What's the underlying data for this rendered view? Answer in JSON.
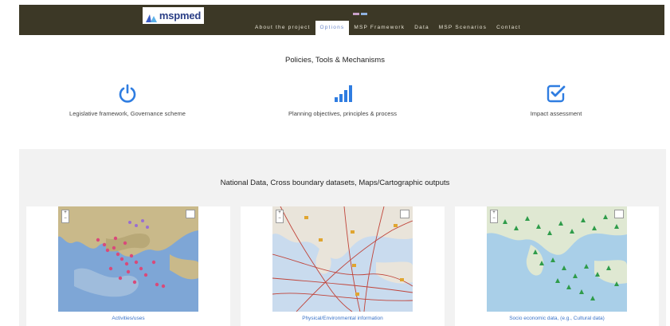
{
  "header": {
    "logo_text": "mspmed",
    "nav": [
      {
        "label": "About the project"
      },
      {
        "label": "Options"
      },
      {
        "label": "MSP Framework"
      },
      {
        "label": "Data"
      },
      {
        "label": "MSP Scenarios"
      },
      {
        "label": "Contact"
      }
    ],
    "active_nav_index": 1
  },
  "policies": {
    "title": "Policies, Tools & Mechanisms",
    "items": [
      {
        "icon": "power-icon",
        "label": "Legislative framework, Governance scheme"
      },
      {
        "icon": "bar-chart-icon",
        "label": "Planning objectives, principles & process"
      },
      {
        "icon": "check-square-icon",
        "label": "Impact assessment"
      }
    ]
  },
  "data_section": {
    "title": "National Data, Cross boundary datasets, Maps/Cartographic outputs",
    "cards": [
      {
        "caption": "Activities/uses",
        "map": "activities-map",
        "zoom_in": "+",
        "zoom_out": "−"
      },
      {
        "caption": "Physical/Environmental information",
        "map": "environmental-map",
        "zoom_in": "+",
        "zoom_out": "−"
      },
      {
        "caption": "Socio economic data, (e.g., Cultural data)",
        "map": "cultural-map",
        "zoom_in": "+",
        "zoom_out": "−"
      }
    ]
  },
  "colors": {
    "header_bg": "#3c3826",
    "accent_blue": "#2f7de1",
    "link_blue": "#3a73c8",
    "band_bg": "#f2f2f2"
  }
}
